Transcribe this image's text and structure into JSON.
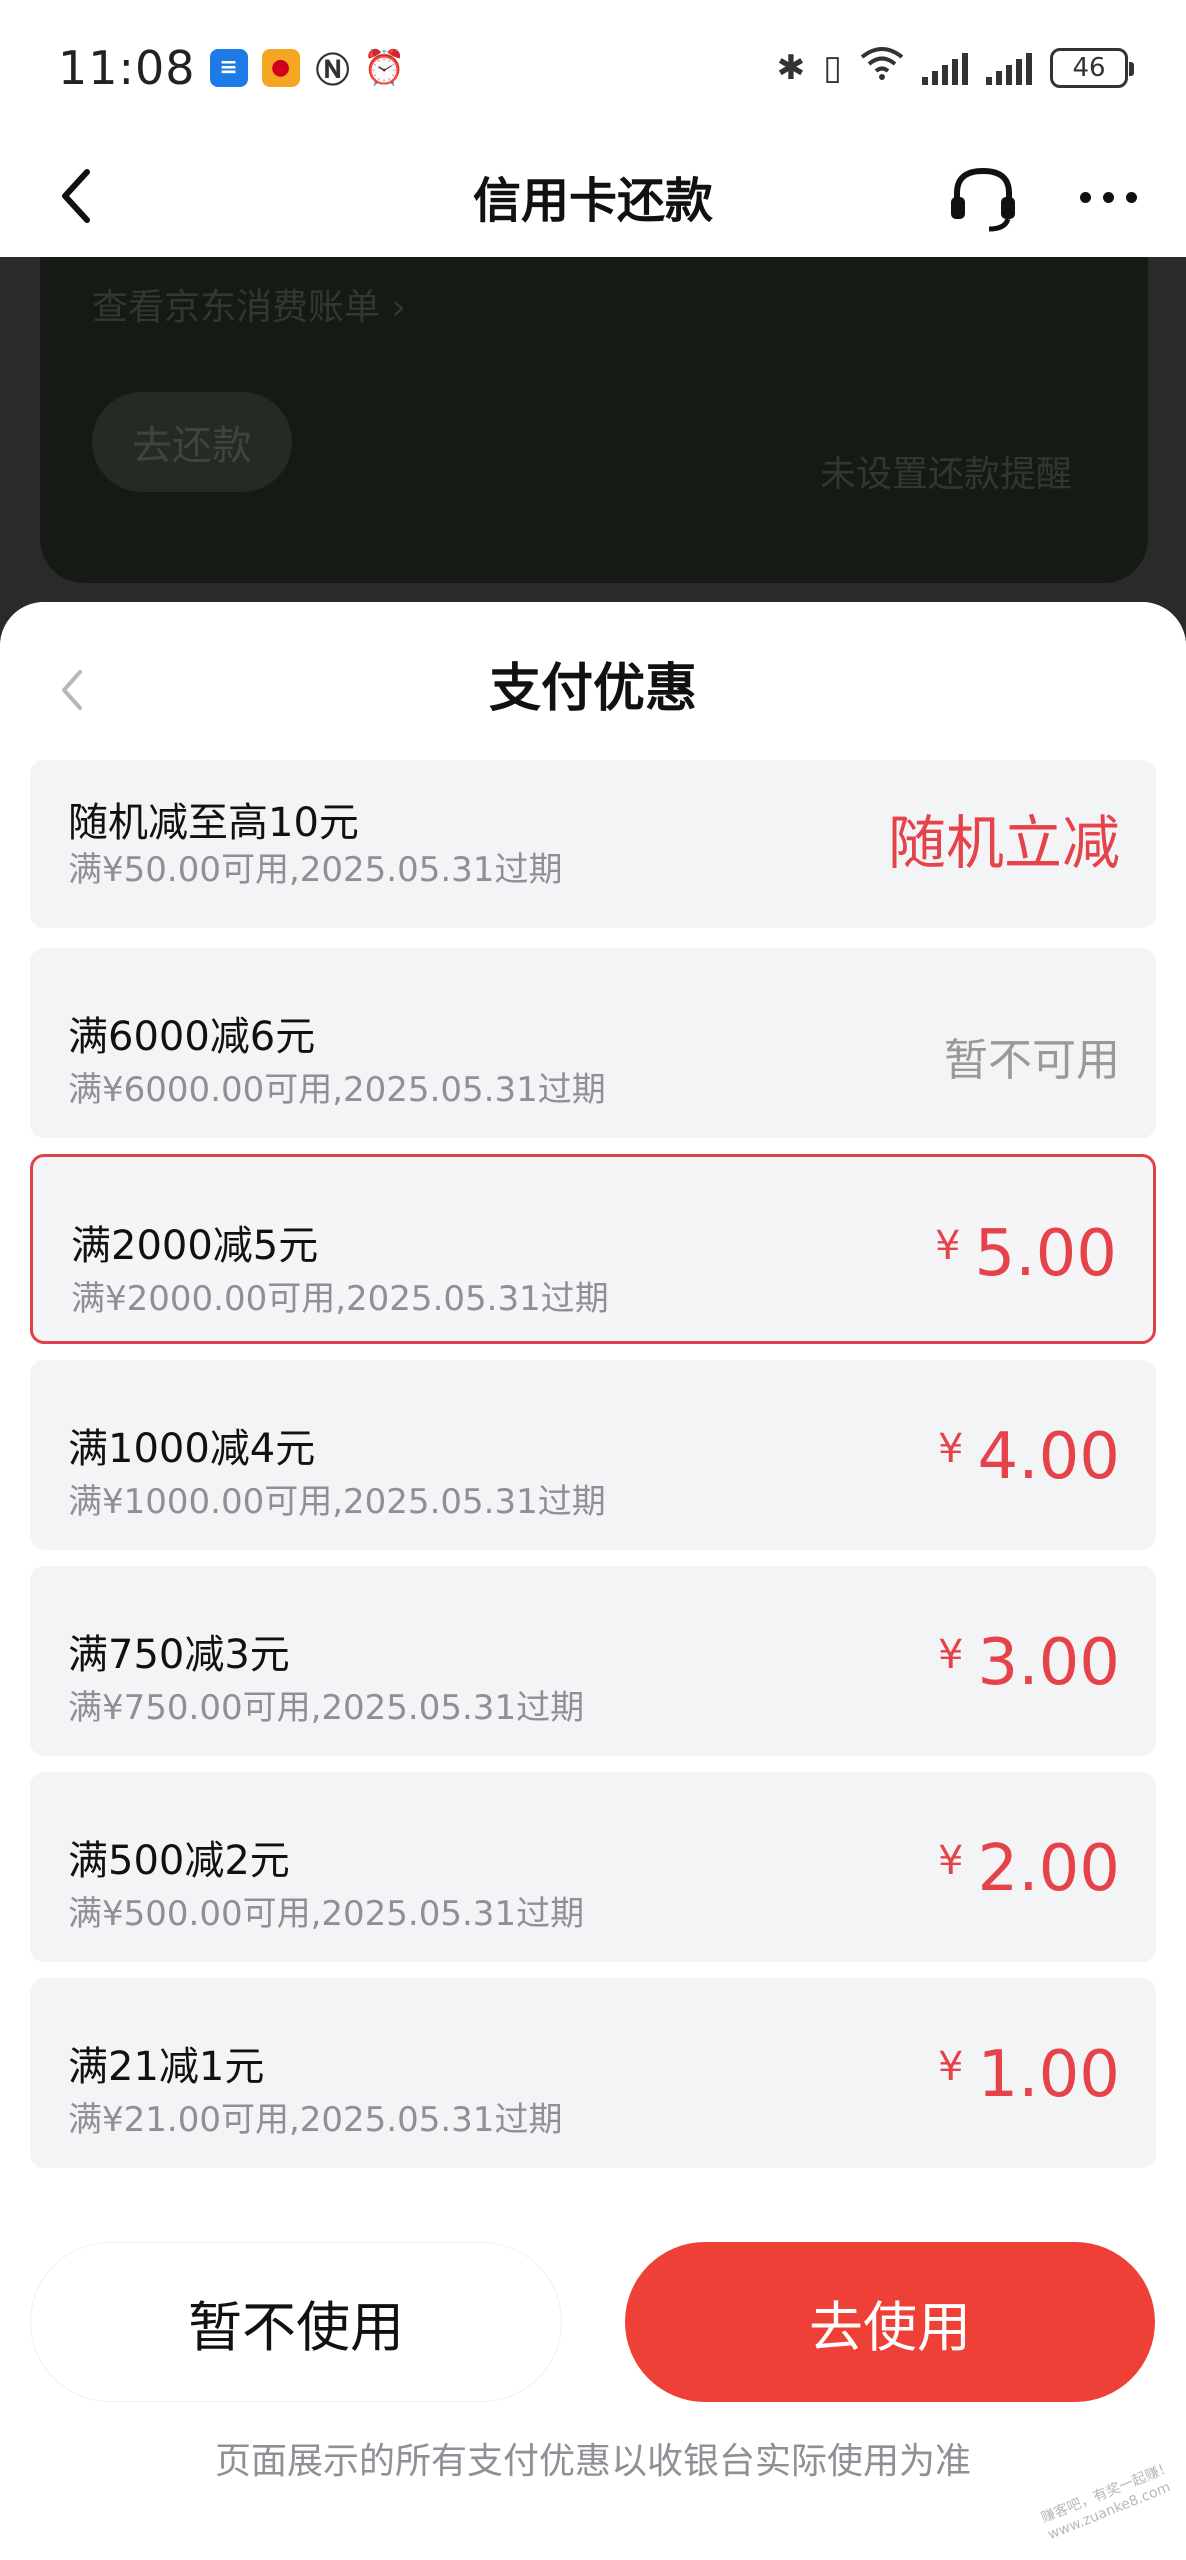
{
  "status_bar": {
    "time": "11:08",
    "battery": "46"
  },
  "nav": {
    "title": "信用卡还款"
  },
  "background": {
    "bill_link": "查看京东消费账单 ›",
    "pay_button": "去还款",
    "reminder": "未设置还款提醒"
  },
  "sheet": {
    "title": "支付优惠",
    "coupons": [
      {
        "name": "随机减至高10元",
        "desc": "满¥50.00可用,2025.05.31过期",
        "action": "随机立减"
      },
      {
        "name": "满6000减6元",
        "desc": "满¥6000.00可用,2025.05.31过期",
        "action": "暂不可用"
      },
      {
        "name": "满2000减5元",
        "desc": "满¥2000.00可用,2025.05.31过期",
        "currency": "¥",
        "amount": "5.00"
      },
      {
        "name": "满1000减4元",
        "desc": "满¥1000.00可用,2025.05.31过期",
        "currency": "¥",
        "amount": "4.00"
      },
      {
        "name": "满750减3元",
        "desc": "满¥750.00可用,2025.05.31过期",
        "currency": "¥",
        "amount": "3.00"
      },
      {
        "name": "满500减2元",
        "desc": "满¥500.00可用,2025.05.31过期",
        "currency": "¥",
        "amount": "2.00"
      },
      {
        "name": "满21减1元",
        "desc": "满¥21.00可用,2025.05.31过期",
        "currency": "¥",
        "amount": "1.00"
      }
    ],
    "skip_label": "暂不使用",
    "use_label": "去使用",
    "footer_note": "页面展示的所有支付优惠以收银台实际使用为准"
  },
  "colors": {
    "accent_red": "#ee4036",
    "price_red": "#e6424a",
    "card_bg": "#f3f4f6"
  },
  "watermark": "赚客吧，有奖一起赚！ www.zuanke8.com"
}
